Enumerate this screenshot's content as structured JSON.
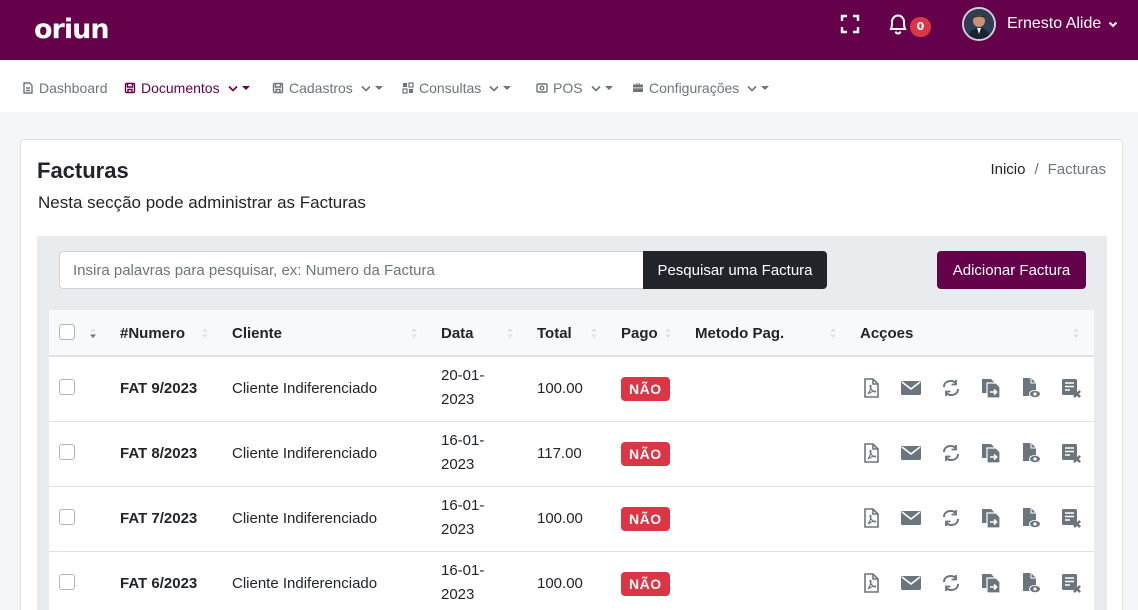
{
  "app": {
    "logo_text": "oriun"
  },
  "topbar": {
    "notifications_count": "0",
    "user_name": "Ernesto Alide"
  },
  "nav": {
    "items": [
      {
        "label": "Dashboard",
        "icon": "dashboard-icon",
        "active": false,
        "dropdown": false
      },
      {
        "label": "Documentos",
        "icon": "documents-icon",
        "active": true,
        "dropdown": true
      },
      {
        "label": "Cadastros",
        "icon": "records-icon",
        "active": false,
        "dropdown": true
      },
      {
        "label": "Consultas",
        "icon": "queries-icon",
        "active": false,
        "dropdown": true
      },
      {
        "label": "POS",
        "icon": "pos-icon",
        "active": false,
        "dropdown": true
      },
      {
        "label": "Configurações",
        "icon": "settings-briefcase-icon",
        "active": false,
        "dropdown": true
      }
    ]
  },
  "page": {
    "title": "Facturas",
    "subtitle": "Nesta secção pode administrar as Facturas",
    "breadcrumb": {
      "home": "Inicio",
      "separator": "/",
      "current": "Facturas"
    }
  },
  "search": {
    "placeholder": "Insira palavras para pesquisar, ex: Numero da Factura",
    "button_label": "Pesquisar uma Factura"
  },
  "add_button_label": "Adicionar Factura",
  "table": {
    "headers": {
      "numero": "#Numero",
      "cliente": "Cliente",
      "data": "Data",
      "total": "Total",
      "pago": "Pago",
      "metodo": "Metodo Pag.",
      "accoes": "Acçoes"
    },
    "rows": [
      {
        "numero": "FAT 9/2023",
        "cliente": "Cliente Indiferenciado",
        "data_line1": "20-01-",
        "data_line2": "2023",
        "total": "100.00",
        "pago": "NÃO",
        "metodo": ""
      },
      {
        "numero": "FAT 8/2023",
        "cliente": "Cliente Indiferenciado",
        "data_line1": "16-01-",
        "data_line2": "2023",
        "total": "117.00",
        "pago": "NÃO",
        "metodo": ""
      },
      {
        "numero": "FAT 7/2023",
        "cliente": "Cliente Indiferenciado",
        "data_line1": "16-01-",
        "data_line2": "2023",
        "total": "100.00",
        "pago": "NÃO",
        "metodo": ""
      },
      {
        "numero": "FAT 6/2023",
        "cliente": "Cliente Indiferenciado",
        "data_line1": "16-01-",
        "data_line2": "2023",
        "total": "100.00",
        "pago": "NÃO",
        "metodo": ""
      }
    ],
    "row_actions": [
      "pdf-icon",
      "email-icon",
      "refresh-icon",
      "copy-document-icon",
      "view-document-icon",
      "cancel-list-icon"
    ]
  },
  "colors": {
    "brand": "#65004a",
    "danger": "#dc3545",
    "dark": "#212529"
  }
}
